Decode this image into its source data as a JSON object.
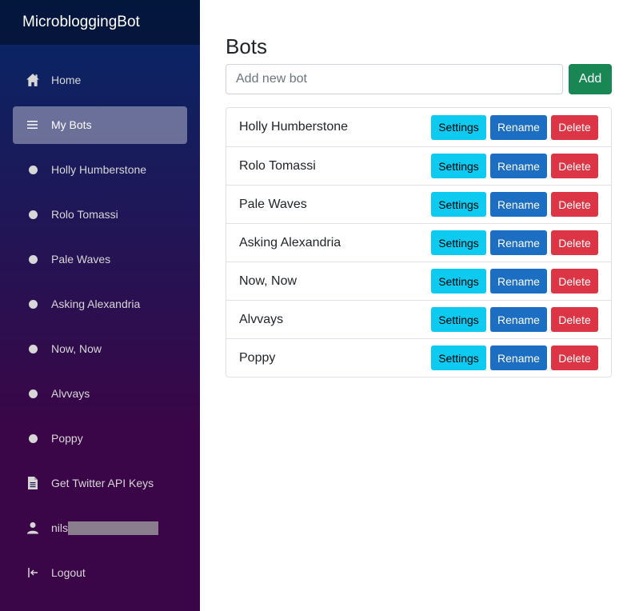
{
  "app": {
    "brand": "MicrobloggingBot"
  },
  "sidebar": {
    "items": [
      {
        "label": "Home",
        "icon": "home-icon",
        "active": false
      },
      {
        "label": "My Bots",
        "icon": "list-icon",
        "active": true
      },
      {
        "label": "Holly Humberstone",
        "icon": "dot-icon"
      },
      {
        "label": "Rolo Tomassi",
        "icon": "dot-icon"
      },
      {
        "label": "Pale Waves",
        "icon": "dot-icon"
      },
      {
        "label": "Asking Alexandria",
        "icon": "dot-icon"
      },
      {
        "label": "Now, Now",
        "icon": "dot-icon"
      },
      {
        "label": "Alvvays",
        "icon": "dot-icon"
      },
      {
        "label": "Poppy",
        "icon": "dot-icon"
      },
      {
        "label": "Get Twitter API Keys",
        "icon": "document-icon"
      },
      {
        "label": "nils",
        "icon": "user-icon"
      },
      {
        "label": "Logout",
        "icon": "logout-icon"
      }
    ]
  },
  "main": {
    "title": "Bots",
    "add_placeholder": "Add new bot",
    "add_label": "Add",
    "settings_label": "Settings",
    "rename_label": "Rename",
    "delete_label": "Delete",
    "bots": [
      "Holly Humberstone",
      "Rolo Tomassi",
      "Pale Waves",
      "Asking Alexandria",
      "Now, Now",
      "Alvvays",
      "Poppy"
    ]
  },
  "colors": {
    "sidebar_top": "#052767",
    "sidebar_bottom": "#3a0647",
    "add_button": "#198754",
    "settings_button": "#0dcaf0",
    "rename_button": "#1b6ec2",
    "delete_button": "#dc3545"
  }
}
